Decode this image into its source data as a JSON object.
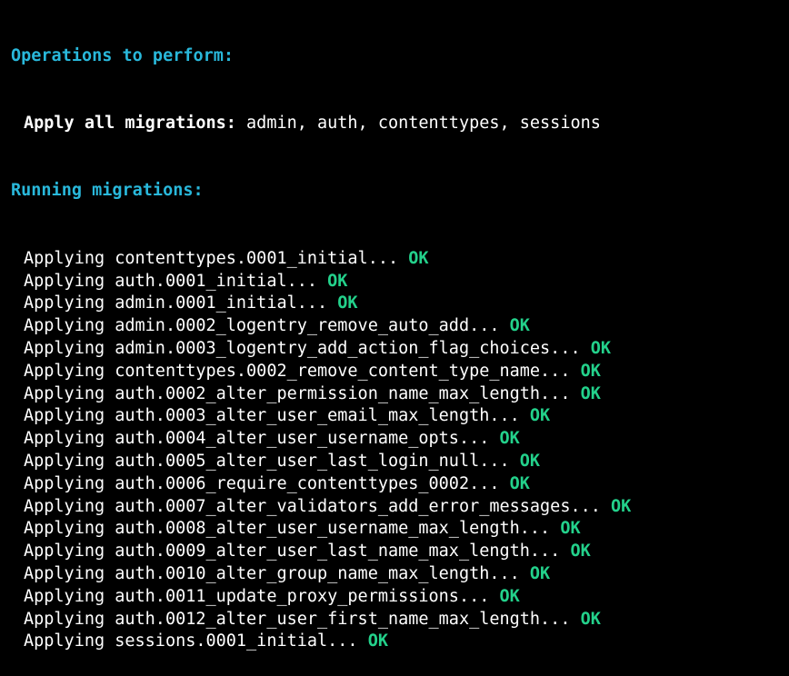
{
  "operations_heading": "Operations to perform:",
  "apply_all_label": "Apply all migrations:",
  "apply_all_apps": " admin, auth, contenttypes, sessions",
  "running_heading": "Running migrations:",
  "applying_prefix": "Applying ",
  "ok_text": "OK",
  "colors": {
    "background": "#000000",
    "heading": "#29b8db",
    "text": "#ffffff",
    "ok": "#23d18b"
  },
  "migrations": [
    "contenttypes.0001_initial...",
    "auth.0001_initial...",
    "admin.0001_initial...",
    "admin.0002_logentry_remove_auto_add...",
    "admin.0003_logentry_add_action_flag_choices...",
    "contenttypes.0002_remove_content_type_name...",
    "auth.0002_alter_permission_name_max_length...",
    "auth.0003_alter_user_email_max_length...",
    "auth.0004_alter_user_username_opts...",
    "auth.0005_alter_user_last_login_null...",
    "auth.0006_require_contenttypes_0002...",
    "auth.0007_alter_validators_add_error_messages...",
    "auth.0008_alter_user_username_max_length...",
    "auth.0009_alter_user_last_name_max_length...",
    "auth.0010_alter_group_name_max_length...",
    "auth.0011_update_proxy_permissions...",
    "auth.0012_alter_user_first_name_max_length...",
    "sessions.0001_initial..."
  ]
}
